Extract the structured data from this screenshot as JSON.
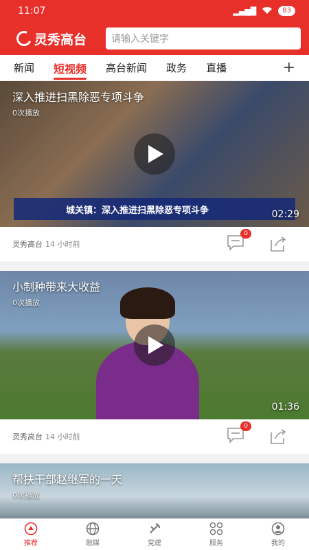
{
  "status_bar": {
    "time": "11:07",
    "signal": "4G",
    "battery": "83"
  },
  "header": {
    "app_name": "灵秀高台",
    "search_placeholder": "请输入关键字"
  },
  "tabs": [
    {
      "label": "新闻",
      "active": false
    },
    {
      "label": "短视频",
      "active": true
    },
    {
      "label": "高台新闻",
      "active": false
    },
    {
      "label": "政务",
      "active": false
    },
    {
      "label": "直播",
      "active": false
    }
  ],
  "tab_add": "+",
  "feed": [
    {
      "title": "深入推进扫黑除恶专项斗争",
      "plays": "0次播放",
      "duration": "02:29",
      "ticker": "城关镇：深入推进扫黑除恶专项斗争",
      "source": "灵秀高台",
      "time": "14 小时前",
      "comments": "0"
    },
    {
      "title": "小制种带来大收益",
      "plays": "0次播放",
      "duration": "01:36",
      "source": "灵秀高台",
      "time": "14 小时前",
      "comments": "0"
    },
    {
      "title": "帮扶干部赵继军的一天",
      "plays": "0次播放"
    }
  ],
  "bottom_nav": [
    {
      "label": "推荐",
      "icon": "recommend-icon",
      "active": true
    },
    {
      "label": "融媒",
      "icon": "news-globe-icon",
      "active": false
    },
    {
      "label": "党建",
      "icon": "party-icon",
      "active": false
    },
    {
      "label": "服务",
      "icon": "grid-icon",
      "active": false
    },
    {
      "label": "我的",
      "icon": "user-icon",
      "active": false
    }
  ],
  "colors": {
    "brand_red": "#e8302b"
  }
}
